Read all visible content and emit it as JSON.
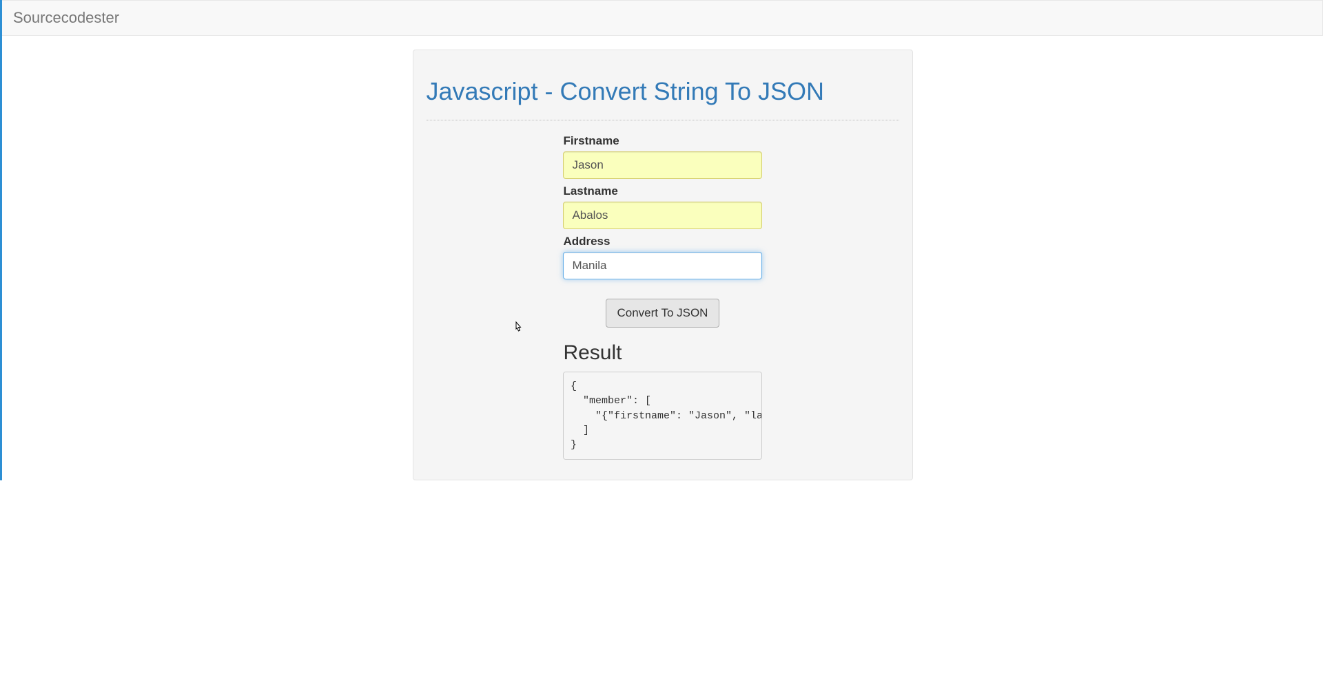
{
  "navbar": {
    "brand": "Sourcecodester"
  },
  "page": {
    "title": "Javascript - Convert String To JSON"
  },
  "form": {
    "firstname_label": "Firstname",
    "firstname_value": "Jason",
    "lastname_label": "Lastname",
    "lastname_value": "Abalos",
    "address_label": "Address",
    "address_value": "Manila",
    "convert_button": "Convert To JSON"
  },
  "result": {
    "heading": "Result",
    "content": "{\n  \"member\": [\n    \"{\"firstname\": \"Jason\", \"lastname\": \"Abalos\", \"address\": \"Manila\"}\"\n  ]\n}"
  }
}
